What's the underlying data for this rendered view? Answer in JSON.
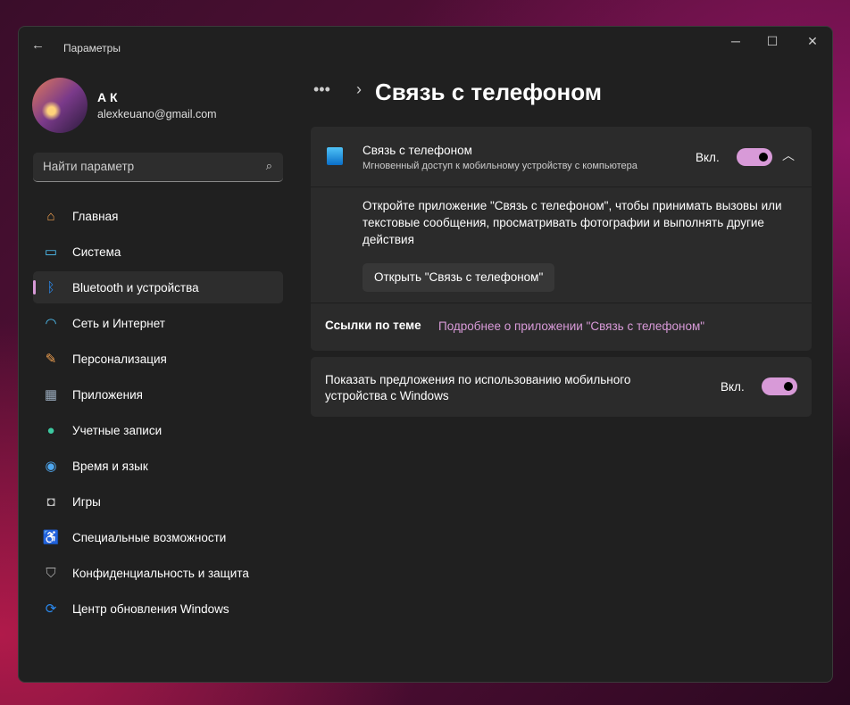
{
  "window": {
    "title": "Параметры",
    "back": "←",
    "minimize": "─",
    "maximize": "☐",
    "close": "✕"
  },
  "user": {
    "name": "А К",
    "email": "alexkeuano@gmail.com"
  },
  "search": {
    "placeholder": "Найти параметр",
    "icon": "⌕"
  },
  "sidebar": {
    "items": [
      {
        "label": "Главная",
        "icon": "home-icon",
        "glyph": "⌂",
        "color": "#f0a050"
      },
      {
        "label": "Система",
        "icon": "monitor-icon",
        "glyph": "▭",
        "color": "#4fc3f7"
      },
      {
        "label": "Bluetooth и устройства",
        "icon": "bluetooth-icon",
        "glyph": "ᛒ",
        "color": "#2a8af0"
      },
      {
        "label": "Сеть и Интернет",
        "icon": "wifi-icon",
        "glyph": "◠",
        "color": "#4fc3f7"
      },
      {
        "label": "Персонализация",
        "icon": "brush-icon",
        "glyph": "✎",
        "color": "#f0a050"
      },
      {
        "label": "Приложения",
        "icon": "apps-icon",
        "glyph": "▦",
        "color": "#9ab"
      },
      {
        "label": "Учетные записи",
        "icon": "person-icon",
        "glyph": "●",
        "color": "#3cc8a0"
      },
      {
        "label": "Время и язык",
        "icon": "globe-icon",
        "glyph": "◉",
        "color": "#4fa8f0"
      },
      {
        "label": "Игры",
        "icon": "gamepad-icon",
        "glyph": "◘",
        "color": "#bbb"
      },
      {
        "label": "Специальные возможности",
        "icon": "accessibility-icon",
        "glyph": "♿",
        "color": "#4fa8f0"
      },
      {
        "label": "Конфиденциальность и защита",
        "icon": "shield-icon",
        "glyph": "⛉",
        "color": "#aaa"
      },
      {
        "label": "Центр обновления Windows",
        "icon": "update-icon",
        "glyph": "⟳",
        "color": "#2a8af0"
      }
    ],
    "selected": 2
  },
  "main": {
    "breadcrumb_more": "•••",
    "breadcrumb_sep": "›",
    "title": "Связь с телефоном",
    "phone_link": {
      "title": "Связь с телефоном",
      "subtitle": "Мгновенный доступ к мобильному устройству с компьютера",
      "state": "Вкл.",
      "on": true,
      "description": "Откройте приложение \"Связь с телефоном\", чтобы принимать вызовы или текстовые сообщения, просматривать фотографии и выполнять другие действия",
      "open_button": "Открыть \"Связь с телефоном\"",
      "related_label": "Ссылки по теме",
      "related_link": "Подробнее о приложении \"Связь с телефоном\""
    },
    "suggestions": {
      "label": "Показать предложения по использованию мобильного устройства с Windows",
      "state": "Вкл.",
      "on": true
    }
  }
}
